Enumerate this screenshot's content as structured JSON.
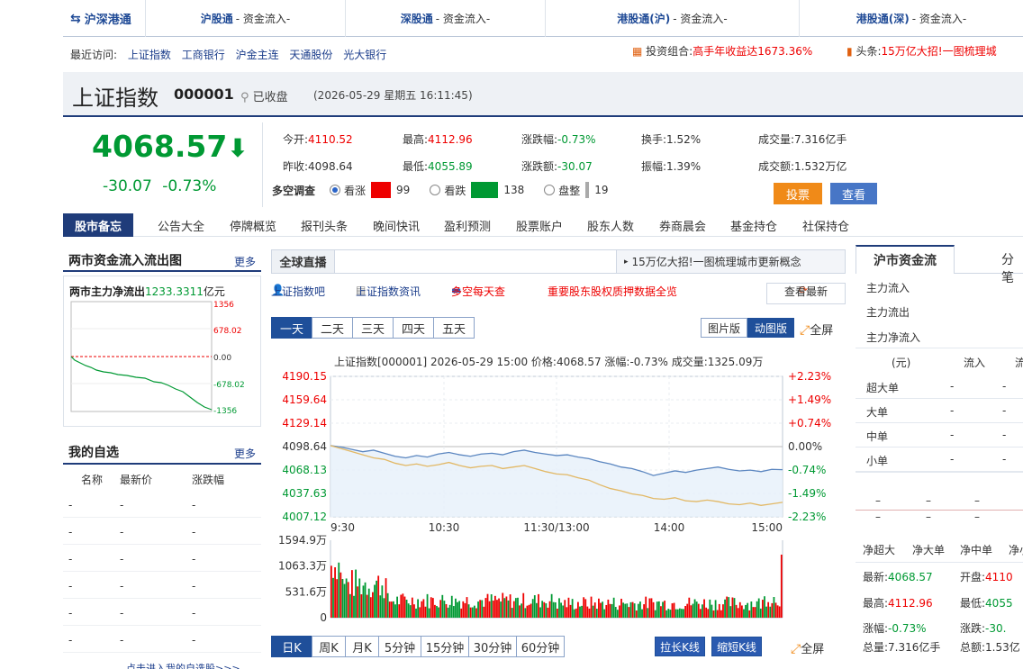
{
  "topbar": {
    "logo": "沪深港通",
    "items": [
      {
        "name": "沪股通",
        "suffix": " - 资金流入-"
      },
      {
        "name": "深股通",
        "suffix": " - 资金流入-"
      },
      {
        "name": "港股通(沪)",
        "suffix": " - 资金流入-"
      },
      {
        "name": "港股通(深)",
        "suffix": " - 资金流入-"
      }
    ]
  },
  "recent": {
    "label": "最近访问:",
    "links": [
      "上证指数",
      "工商银行",
      "沪金主连",
      "天通股份",
      "光大银行"
    ]
  },
  "portfolio": {
    "label": "投资组合:",
    "text": "高手年收益达1673.36%"
  },
  "headline": {
    "label": "头条:",
    "text": "15万亿大招!一图梳理城"
  },
  "title": {
    "name": "上证指数",
    "code": "000001",
    "status": "已收盘",
    "time": "(2026-05-29 星期五 16:11:45)"
  },
  "quote": {
    "price": "4068.57",
    "change": "-30.07",
    "change_pct": "-0.73%",
    "open_label": "今开:",
    "open": "4110.52",
    "high_label": "最高:",
    "high": "4112.96",
    "pct_label": "涨跌幅:",
    "pct": "-0.73%",
    "turnover_label": "换手:",
    "turnover": "1.52%",
    "volume_label": "成交量:",
    "volume": "7.316亿手",
    "prev_label": "昨收:",
    "prev": "4098.64",
    "low_label": "最低:",
    "low": "4055.89",
    "chg_label": "涨跌额:",
    "chg": "-30.07",
    "amp_label": "振幅:",
    "amp": "1.39%",
    "amount_label": "成交额:",
    "amount": "1.532万亿"
  },
  "survey": {
    "label": "多空调查",
    "up_label": "看涨",
    "up": "99",
    "down_label": "看跌",
    "down": "138",
    "flat_label": "盘整",
    "flat": "19",
    "vote": "投票",
    "view": "查看"
  },
  "nav": {
    "tag": "股市备忘",
    "items": [
      "公告大全",
      "停牌概览",
      "报刊头条",
      "晚间快讯",
      "盈利预测",
      "股票账户",
      "股东人数",
      "券商晨会",
      "基金持仓",
      "社保持仓"
    ]
  },
  "fundflow": {
    "title": "两市资金流入流出图",
    "more": "更多",
    "label": "两市主力净流出",
    "value": "1233.3311",
    "unit": "亿元",
    "axis": [
      "1356",
      "678.02",
      "0.00",
      "-678.02",
      "-1356"
    ]
  },
  "watch": {
    "title": "我的自选",
    "more": "更多",
    "cols": [
      "名称",
      "最新价",
      "涨跌幅"
    ],
    "rows": [
      [
        "-",
        "-",
        "-"
      ],
      [
        "-",
        "-",
        "-"
      ],
      [
        "-",
        "-",
        "-"
      ],
      [
        "-",
        "-",
        "-"
      ],
      [
        "-",
        "-",
        "-"
      ],
      [
        "-",
        "-",
        "-"
      ]
    ],
    "footer": "点击进入我的自选股>>>"
  },
  "live": {
    "tag": "全球直播",
    "news": "15万亿大招!一图梳理城市更新概念"
  },
  "links": {
    "bar": "上证指数吧",
    "info": "上证指数资讯",
    "daily": "多空每天查",
    "pledge": "重要股东股权质押数据全览",
    "refresh": "查看最新"
  },
  "periods": [
    "一天",
    "二天",
    "三天",
    "四天",
    "五天"
  ],
  "view_modes": [
    "图片版",
    "动图版"
  ],
  "fullscreen": "全屏",
  "kline_tabs": [
    "日K",
    "周K",
    "月K",
    "5分钟",
    "15分钟",
    "30分钟",
    "60分钟"
  ],
  "kline_btns": [
    "拉长K线",
    "缩短K线"
  ],
  "chart_data": {
    "type": "line",
    "header": "上证指数[000001]  2026-05-29 15:00  价格:4068.57  涨幅:-0.73%  成交量:1325.09万",
    "y_left": [
      "4190.15",
      "4159.64",
      "4129.14",
      "4098.64",
      "4068.13",
      "4037.63",
      "4007.12"
    ],
    "y_right": [
      "+2.23%",
      "+1.49%",
      "+0.74%",
      "0.00%",
      "-0.74%",
      "-1.49%",
      "-2.23%"
    ],
    "x_labels": [
      "9:30",
      "10:30",
      "11:30/13:00",
      "14:00",
      "15:00"
    ],
    "ylim": [
      4007.12,
      4190.15
    ],
    "prev_close": 4098.64,
    "series": [
      {
        "values": [
          4100,
          4098,
          4095,
          4092,
          4094,
          4090,
          4086,
          4084,
          4087,
          4085,
          4089,
          4091,
          4088,
          4086,
          4089,
          4090,
          4088,
          4092,
          4094,
          4091,
          4089,
          4087,
          4088,
          4085,
          4083,
          4079,
          4076,
          4072,
          4070,
          4066,
          4061,
          4064,
          4067,
          4065,
          4068,
          4070,
          4072,
          4069,
          4067,
          4068,
          4066,
          4069,
          4068.57
        ]
      },
      {
        "values": [
          4100,
          4096,
          4092,
          4088,
          4084,
          4082,
          4077,
          4074,
          4076,
          4073,
          4075,
          4078,
          4074,
          4071,
          4073,
          4074,
          4070,
          4072,
          4074,
          4070,
          4066,
          4063,
          4062,
          4058,
          4055,
          4049,
          4044,
          4041,
          4037,
          4035,
          4031,
          4030,
          4032,
          4028,
          4027,
          4029,
          4027,
          4024,
          4023,
          4025,
          4022,
          4024,
          4026
        ]
      }
    ],
    "volume_axis": [
      "1594.9万",
      "1063.3万",
      "531.6万",
      "0"
    ]
  },
  "right": {
    "tab_on": "沪市资金流",
    "tab_off": "分笔",
    "flows": [
      "主力流入",
      "主力流出",
      "主力净流入"
    ],
    "table_head": [
      "(元)",
      "流入",
      "流"
    ],
    "table_rows": [
      [
        "超大单",
        "-",
        "-"
      ],
      [
        "大单",
        "-",
        "-"
      ],
      [
        "中单",
        "-",
        "-"
      ],
      [
        "小单",
        "-",
        "-"
      ]
    ],
    "cat_labels": [
      "净超大",
      "净大单",
      "净中单",
      "净小"
    ],
    "latest_label": "最新:",
    "latest": "4068.57",
    "open_label": "开盘:",
    "open": "4110",
    "high_label": "最高:",
    "high": "4112.96",
    "low_label": "最低:",
    "low": "4055",
    "pct_label": "涨幅:",
    "pct": "-0.73%",
    "chg_label": "涨跌:",
    "chg": "-30.",
    "vol_label": "总量:",
    "vol": "7.316亿手",
    "amt_label": "总额:",
    "amt": "1.53亿"
  }
}
